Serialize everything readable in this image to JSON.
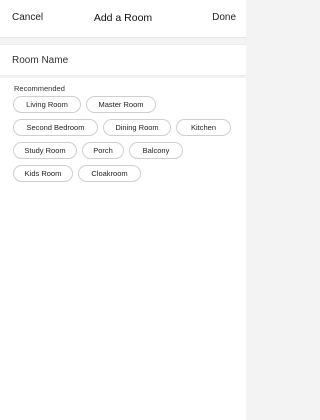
{
  "header": {
    "cancel_label": "Cancel",
    "title": "Add a Room",
    "done_label": "Done"
  },
  "room_name": {
    "placeholder": "Room Name",
    "value": ""
  },
  "recommended": {
    "label": "Recommended",
    "rows": [
      [
        "Living Room",
        "Master Room"
      ],
      [
        "Second Bedroom",
        "Dining Room",
        "Kitchen"
      ],
      [
        "Study Room",
        "Porch",
        "Balcony"
      ],
      [
        "Kids Room",
        "Cloakroom"
      ]
    ]
  }
}
